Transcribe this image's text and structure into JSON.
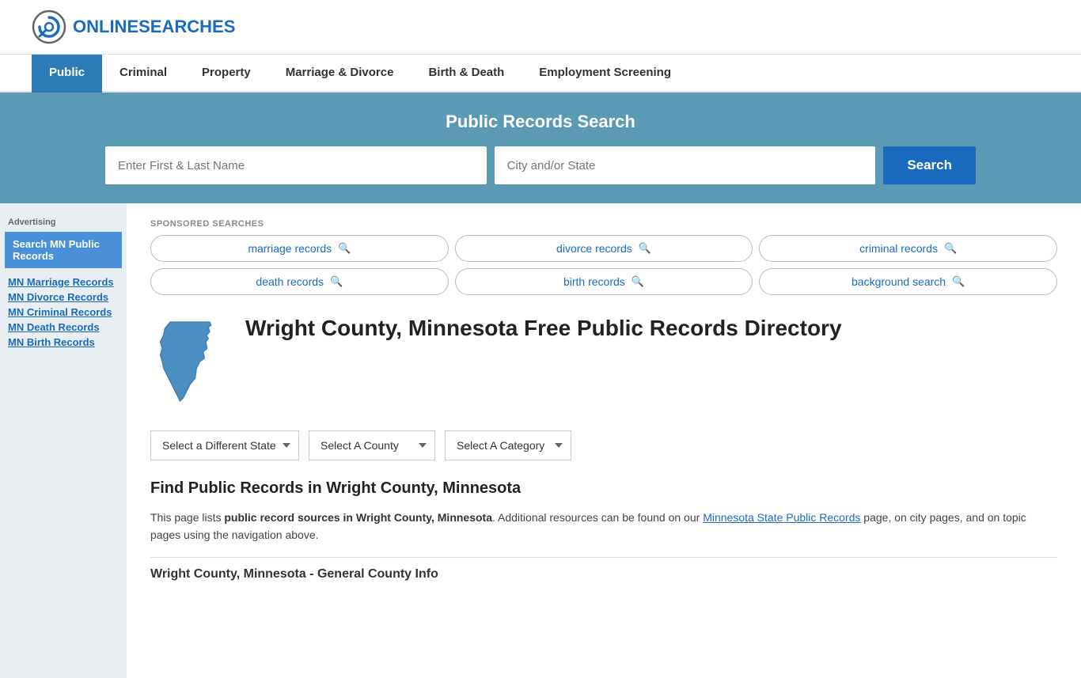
{
  "header": {
    "logo_text_normal": "ONLINE",
    "logo_text_blue": "SEARCHES"
  },
  "nav": {
    "items": [
      {
        "label": "Public",
        "active": true
      },
      {
        "label": "Criminal",
        "active": false
      },
      {
        "label": "Property",
        "active": false
      },
      {
        "label": "Marriage & Divorce",
        "active": false
      },
      {
        "label": "Birth & Death",
        "active": false
      },
      {
        "label": "Employment Screening",
        "active": false
      }
    ]
  },
  "search_banner": {
    "title": "Public Records Search",
    "name_placeholder": "Enter First & Last Name",
    "location_placeholder": "City and/or State",
    "button_label": "Search"
  },
  "sponsored": {
    "label": "SPONSORED SEARCHES",
    "tags": [
      {
        "label": "marriage records"
      },
      {
        "label": "divorce records"
      },
      {
        "label": "criminal records"
      },
      {
        "label": "death records"
      },
      {
        "label": "birth records"
      },
      {
        "label": "background search"
      }
    ]
  },
  "sidebar": {
    "ad_label": "Advertising",
    "ad_button": "Search MN Public Records",
    "links": [
      {
        "label": "MN Marriage Records"
      },
      {
        "label": "MN Divorce Records"
      },
      {
        "label": "MN Criminal Records"
      },
      {
        "label": "MN Death Records"
      },
      {
        "label": "MN Birth Records"
      }
    ]
  },
  "main": {
    "page_title": "Wright County, Minnesota Free Public Records Directory",
    "dropdown_state": "Select a Different State",
    "dropdown_county": "Select A County",
    "dropdown_category": "Select A Category",
    "find_title": "Find Public Records in Wright County, Minnesota",
    "find_desc_1": "This page lists ",
    "find_desc_bold": "public record sources in Wright County, Minnesota",
    "find_desc_2": ". Additional resources can be found on our ",
    "find_link": "Minnesota State Public Records",
    "find_desc_3": " page, on city pages, and on topic pages using the navigation above.",
    "county_info_title": "Wright County, Minnesota - General County Info"
  }
}
